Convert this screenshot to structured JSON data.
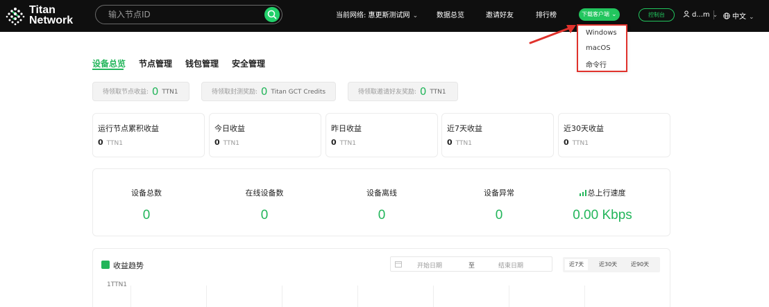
{
  "header": {
    "logo_line1": "Titan",
    "logo_line2": "Network",
    "search_placeholder": "输入节点ID",
    "network": "当前网络: 惠更斯测试网",
    "nav_overview": "数据总览",
    "nav_invite": "邀请好友",
    "nav_ranking": "排行榜",
    "download_label": "下载客户端",
    "console_label": "控制台",
    "user_name": "d...m",
    "language": "中文"
  },
  "download_menu": {
    "items": [
      "Windows",
      "macOS",
      "命令行"
    ]
  },
  "tabs": [
    "设备总览",
    "节点管理",
    "钱包管理",
    "安全管理"
  ],
  "pending": [
    {
      "label": "待领取节点收益:",
      "value": "0",
      "unit": "TTN1"
    },
    {
      "label": "待领取封测奖励:",
      "value": "0",
      "unit": "Titan GCT Credits"
    },
    {
      "label": "待领取邀请好友奖励:",
      "value": "0",
      "unit": "TTN1"
    }
  ],
  "earnings": [
    {
      "title": "运行节点累积收益",
      "value": "0",
      "unit": "TTN1"
    },
    {
      "title": "今日收益",
      "value": "0",
      "unit": "TTN1"
    },
    {
      "title": "昨日收益",
      "value": "0",
      "unit": "TTN1"
    },
    {
      "title": "近7天收益",
      "value": "0",
      "unit": "TTN1"
    },
    {
      "title": "近30天收益",
      "value": "0",
      "unit": "TTN1"
    }
  ],
  "device_stats": [
    {
      "label": "设备总数",
      "value": "0"
    },
    {
      "label": "在线设备数",
      "value": "0"
    },
    {
      "label": "设备离线",
      "value": "0"
    },
    {
      "label": "设备异常",
      "value": "0"
    },
    {
      "label": "总上行速度",
      "value": "0.00 Kbps"
    }
  ],
  "trend": {
    "title": "收益趋势",
    "start_placeholder": "开始日期",
    "to": "至",
    "end_placeholder": "结束日期",
    "ranges": [
      "近7天",
      "近30天",
      "近90天"
    ],
    "y_tick": "1TTN1"
  },
  "colors": {
    "accent": "#22b55a",
    "header_bg": "#0f0f0f",
    "highlight": "#e0322c"
  }
}
